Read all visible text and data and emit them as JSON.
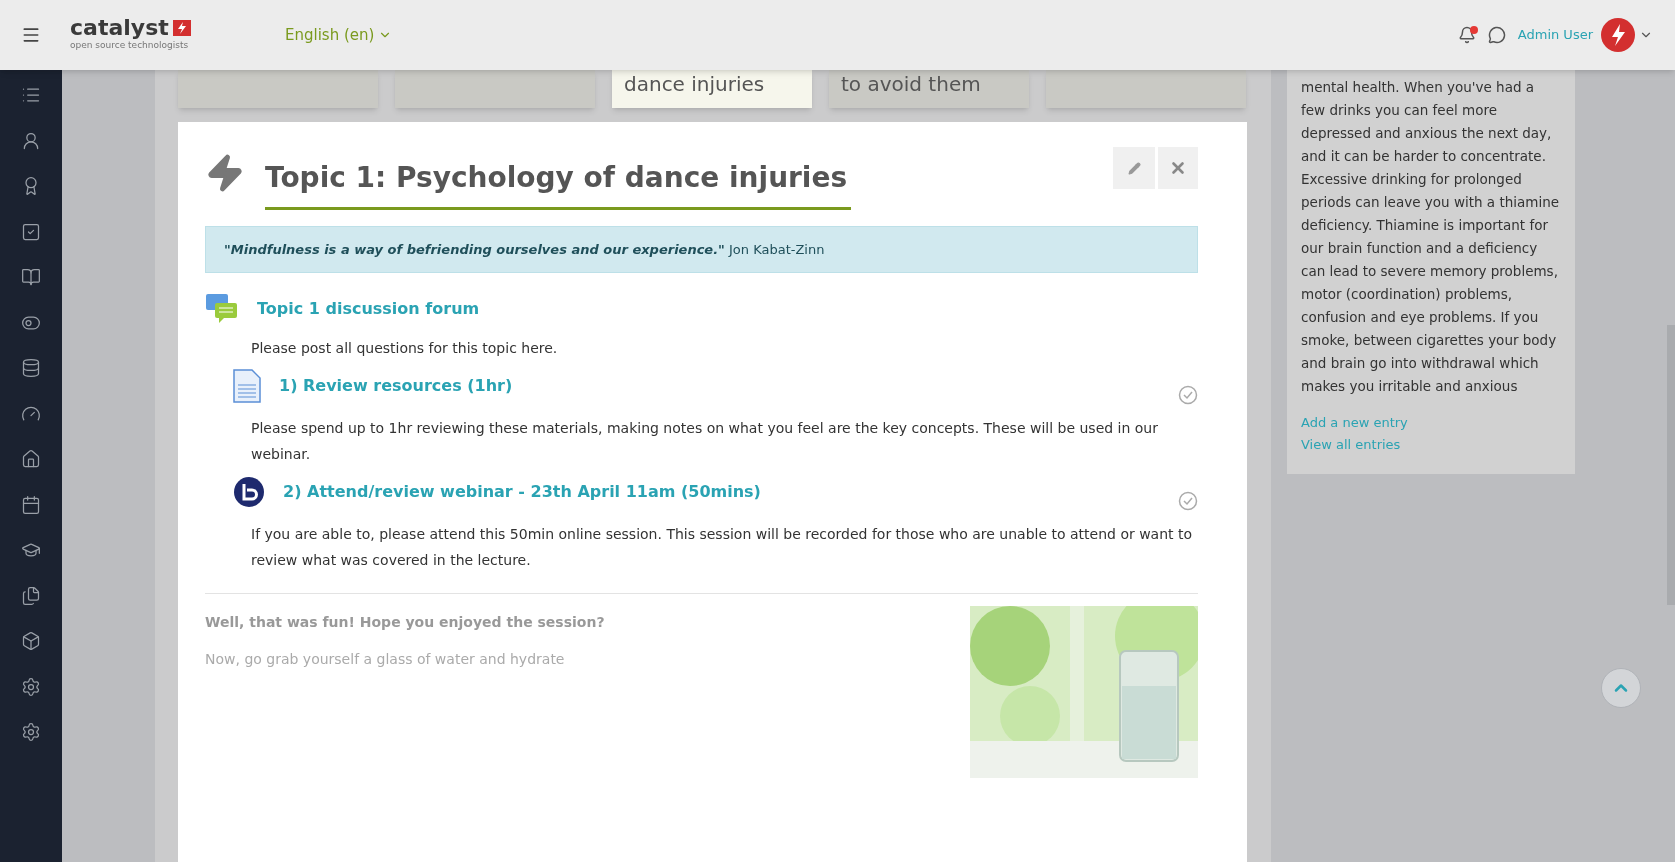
{
  "header": {
    "logo": "catalyst",
    "tagline": "open source technologists",
    "language": "English (en)",
    "user": "Admin User",
    "notification_dot": true
  },
  "tabs": [
    {
      "selected": false
    },
    {
      "selected": false
    },
    {
      "label": "dance injuries",
      "selected": true
    },
    {
      "label": "to avoid them",
      "selected": false
    },
    {
      "selected": false
    }
  ],
  "topic": {
    "title": "Topic 1: Psychology of dance injuries",
    "quote": {
      "text": "\"Mindfulness is a way of befriending ourselves and our experience.\"",
      "author": "Jon Kabat-Zinn"
    },
    "activities": [
      {
        "kind": "forum",
        "title": "Topic 1 discussion forum",
        "description": "Please post all questions for this topic here."
      },
      {
        "kind": "resource",
        "title": "1) Review resources (1hr)",
        "completed": false,
        "description": "Please spend up to 1hr reviewing these materials, making notes on what you feel are the key concepts. These will be used in our webinar."
      },
      {
        "kind": "webinar",
        "title": "2) Attend/review webinar - 23th April 11am (50mins)",
        "completed": false,
        "description": "If you are able to, please attend this 50min online session. This session will be recorded for those who are unable to attend or want to review what was covered in the lecture."
      }
    ],
    "closing": {
      "heading": "Well, that was fun! Hope you enjoyed the session?",
      "text": "Now, go grab yourself a glass of water and hydrate"
    }
  },
  "side_block": {
    "text": "mental health. When you've had a few drinks you can feel more depressed and anxious the next day, and it can be harder to concentrate. Excessive drinking for prolonged periods can leave you with a thiamine deficiency. Thiamine is important for our brain function and a deficiency can lead to severe memory problems, motor (coordination) problems, confusion and eye problems.  If you smoke, between cigarettes your body and brain go into withdrawal which makes you irritable and anxious",
    "links": [
      "Add a new entry",
      "View all entries"
    ]
  }
}
